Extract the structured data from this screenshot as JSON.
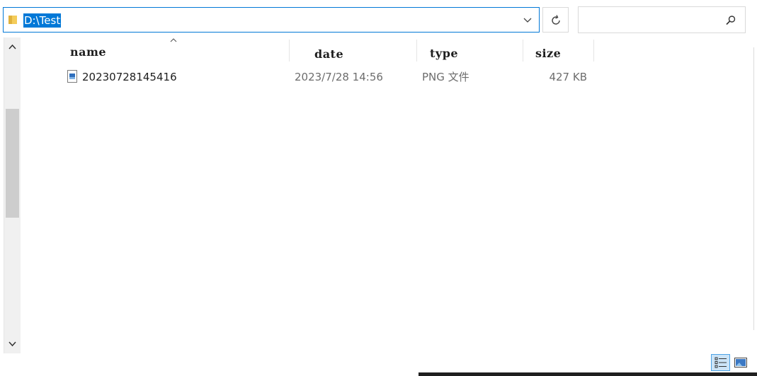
{
  "address_bar": {
    "path": "D:\\Test"
  },
  "search": {
    "placeholder": ""
  },
  "columns": {
    "name": "name",
    "date": "date",
    "type": "type",
    "size": "size"
  },
  "files": [
    {
      "name": "20230728145416",
      "date": "2023/7/28 14:56",
      "type": "PNG 文件",
      "size": "427 KB",
      "icon": "png-image-file-icon"
    }
  ],
  "scrollbar": {
    "thumb_position": 0.28,
    "thumb_size": 0.34
  },
  "view_mode": "details",
  "colors": {
    "accent": "#0078d7",
    "folder": "#f4cc5a",
    "selected_view": "#cce4f7"
  }
}
